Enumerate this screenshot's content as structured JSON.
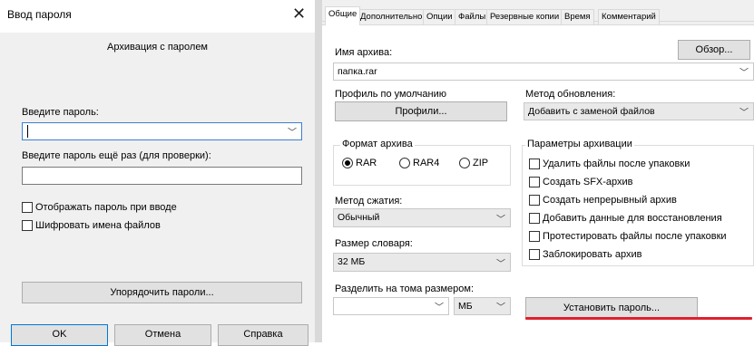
{
  "password_dialog": {
    "title": "Ввод пароля",
    "close_glyph": "✕",
    "heading": "Архивация с паролем",
    "password_label": "Введите пароль:",
    "password_value": "",
    "repeat_label": "Введите пароль ещё раз (для проверки):",
    "repeat_value": "",
    "show_password_label": "Отображать пароль при вводе",
    "show_password_checked": false,
    "encrypt_names_label": "Шифровать имена файлов",
    "encrypt_names_checked": false,
    "organize_button": "Упорядочить пароли...",
    "ok_button": "OK",
    "cancel_button": "Отмена",
    "help_button": "Справка"
  },
  "archive_dialog": {
    "tabs": [
      {
        "label": "Общие",
        "active": true
      },
      {
        "label": "Дополнительно",
        "active": false
      },
      {
        "label": "Опции",
        "active": false
      },
      {
        "label": "Файлы",
        "active": false
      },
      {
        "label": "Резервные копии",
        "active": false
      },
      {
        "label": "Время",
        "active": false
      },
      {
        "label": "Комментарий",
        "active": false
      }
    ],
    "archive_name_label": "Имя архива:",
    "browse_button": "Обзор...",
    "archive_name_value": "папка.rar",
    "default_profile_label": "Профиль по умолчанию",
    "profiles_button": "Профили...",
    "update_method_label": "Метод обновления:",
    "update_method_value": "Добавить с заменой файлов",
    "format_group_title": "Формат архива",
    "formats": [
      {
        "label": "RAR",
        "selected": true
      },
      {
        "label": "RAR4",
        "selected": false
      },
      {
        "label": "ZIP",
        "selected": false
      }
    ],
    "compression_label": "Метод сжатия:",
    "compression_value": "Обычный",
    "dictionary_label": "Размер словаря:",
    "dictionary_value": "32 МБ",
    "split_label": "Разделить на тома размером:",
    "split_value": "",
    "split_unit": "МБ",
    "options_group_title": "Параметры архивации",
    "options": [
      {
        "label": "Удалить файлы после упаковки",
        "checked": false
      },
      {
        "label": "Создать SFX-архив",
        "checked": false
      },
      {
        "label": "Создать непрерывный архив",
        "checked": false
      },
      {
        "label": "Добавить данные для восстановления",
        "checked": false
      },
      {
        "label": "Протестировать файлы после упаковки",
        "checked": false
      },
      {
        "label": "Заблокировать архив",
        "checked": false
      }
    ],
    "set_password_button": "Установить пароль...",
    "highlight_color": "#e0202c"
  }
}
